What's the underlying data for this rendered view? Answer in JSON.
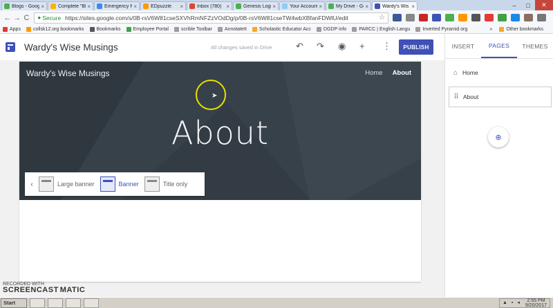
{
  "browser": {
    "tabs": [
      {
        "label": "Blogs - Goog",
        "color": "#4caf50"
      },
      {
        "label": "Complete \"Bl",
        "color": "#ffb300"
      },
      {
        "label": "Emergency Pl",
        "color": "#4285f4"
      },
      {
        "label": "EDpuzzle",
        "color": "#ff9800"
      },
      {
        "label": "Inbox (780)",
        "color": "#db4437"
      },
      {
        "label": "Genesis Login",
        "color": "#4caf50"
      },
      {
        "label": "Your Account",
        "color": "#90caf9"
      },
      {
        "label": "My Drive - Go",
        "color": "#4caf50"
      },
      {
        "label": "Wardy's Wis",
        "color": "#3f51b5",
        "active": true
      }
    ],
    "tab_close": "×",
    "window_controls": {
      "minimize": "–",
      "maximize": "□",
      "close": "✕"
    },
    "nav": {
      "back": "←",
      "forward": "→",
      "reload": "C"
    },
    "secure_label": "Secure",
    "url": "https://sites.google.com/s/0B-rsV6W81cseSXVhRmNFZzVOdDg/p/0B-rsV6W81cseTW4wbXBfanFDWlU/edit",
    "bookmarks": [
      {
        "label": "Apps",
        "color": "#e53935"
      },
      {
        "label": "collsk12.org bookmarks",
        "color": "#ff9800"
      },
      {
        "label": "Bookmarks",
        "color": "#555555"
      },
      {
        "label": "Employee Portal",
        "color": "#43a047"
      },
      {
        "label": "scrible Toolbar",
        "color": "#9e9e9e"
      },
      {
        "label": "AnnotateIt",
        "color": "#9e9e9e"
      },
      {
        "label": "Scholastic Educator Acc",
        "color": "#f9a825"
      },
      {
        "label": "DGDP info",
        "color": "#9e9e9e"
      },
      {
        "label": "PARCC | English Langu",
        "color": "#9e9e9e"
      },
      {
        "label": "Inverted Pyramid org",
        "color": "#9e9e9e"
      }
    ],
    "bookmarks_more": "»",
    "other_bookmarks": "Other bookmarks"
  },
  "sites": {
    "title": "Wardy's Wise Musings",
    "save_status": "All changes saved in Drive",
    "publish_label": "PUBLISH",
    "icons": {
      "undo": "↶",
      "redo": "↷",
      "preview": "◉",
      "share": "+",
      "more": "⋮"
    }
  },
  "panel": {
    "tabs": [
      {
        "label": "INSERT"
      },
      {
        "label": "PAGES",
        "active": true
      },
      {
        "label": "THEMES"
      }
    ],
    "pages": [
      {
        "label": "Home",
        "icon": "⌂"
      },
      {
        "label": "About",
        "icon": "⠿",
        "selected": true
      }
    ],
    "new_page_icon": "⊕"
  },
  "banner": {
    "site_title": "Wardy's Wise Musings",
    "nav": [
      {
        "label": "Home"
      },
      {
        "label": "About",
        "current": true
      }
    ],
    "heading": "About",
    "options_back": "‹",
    "options": [
      {
        "label": "Large banner"
      },
      {
        "label": "Banner",
        "active": true
      },
      {
        "label": "Title only"
      }
    ]
  },
  "watermark": {
    "line1": "RECORDED WITH",
    "line2": "SCREENCAST",
    "line3": "MATIC"
  },
  "taskbar": {
    "start": "Start",
    "time": "2:55 PM",
    "date": "9/20/2017"
  }
}
